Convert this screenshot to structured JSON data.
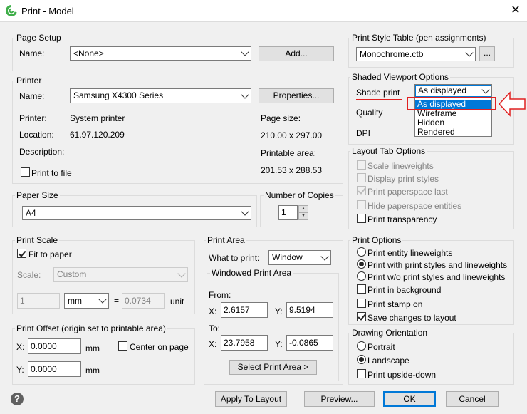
{
  "window": {
    "title": "Print - Model",
    "close_glyph": "✕"
  },
  "page_setup": {
    "title": "Page Setup",
    "name_label": "Name:",
    "name_value": "<None>",
    "add_button": "Add..."
  },
  "printer": {
    "title": "Printer",
    "name_label": "Name:",
    "name_value": "Samsung X4300 Series",
    "properties_button": "Properties...",
    "printer_label": "Printer:",
    "printer_value": "System printer",
    "location_label": "Location:",
    "location_value": "61.97.120.209",
    "description_label": "Description:",
    "page_size_label": "Page size:",
    "page_size_value": "210.00 x 297.00",
    "printable_area_label": "Printable area:",
    "printable_area_value": "201.53 x 288.53",
    "print_to_file": "Print to file"
  },
  "paper_size": {
    "title": "Paper Size",
    "value": "A4"
  },
  "copies": {
    "title": "Number of Copies",
    "value": "1"
  },
  "print_scale": {
    "title": "Print Scale",
    "fit_to_paper": "Fit to paper",
    "scale_label": "Scale:",
    "scale_value": "Custom",
    "num_value": "1",
    "unit_value": "mm",
    "equals": "=",
    "den_value": "0.0734",
    "unit_label": "unit"
  },
  "print_area": {
    "title": "Print Area",
    "what_label": "What to print:",
    "what_value": "Window",
    "windowed_title": "Windowed Print Area",
    "from_label": "From:",
    "to_label": "To:",
    "x_label": "X:",
    "y_label": "Y:",
    "from_x": "2.6157",
    "from_y": "9.5194",
    "to_x": "23.7958",
    "to_y": "-0.0865",
    "select_button": "Select Print Area >"
  },
  "print_offset": {
    "title": "Print Offset (origin set to printable area)",
    "x_label": "X:",
    "x_value": "0.0000",
    "y_label": "Y:",
    "y_value": "0.0000",
    "unit": "mm",
    "center": "Center on page"
  },
  "print_style": {
    "title": "Print Style Table (pen assignments)",
    "value": "Monochrome.ctb",
    "browse": "..."
  },
  "shaded": {
    "title": "Shaded Viewport Options",
    "shade_label": "Shade print",
    "shade_value": "As displayed",
    "quality_label": "Quality",
    "dpi_label": "DPI",
    "options": [
      "As displayed",
      "Wireframe",
      "Hidden",
      "Rendered"
    ]
  },
  "layout_tab": {
    "title": "Layout Tab Options",
    "items": [
      "Scale lineweights",
      "Display print styles",
      "Print paperspace last",
      "Hide paperspace entities",
      "Print transparency"
    ]
  },
  "print_options": {
    "title": "Print Options",
    "radios": [
      "Print entity lineweights",
      "Print with print styles and lineweights",
      "Print w/o print styles and lineweights"
    ],
    "checks": [
      "Print in background",
      "Print stamp on",
      "Save changes to layout"
    ]
  },
  "orientation": {
    "title": "Drawing Orientation",
    "portrait": "Portrait",
    "landscape": "Landscape",
    "upside_down": "Print upside-down"
  },
  "footer": {
    "help": "?",
    "apply": "Apply To Layout",
    "preview": "Preview...",
    "ok": "OK",
    "cancel": "Cancel"
  },
  "colors": {
    "accent": "#0078d7",
    "highlight_red": "#e02020"
  }
}
